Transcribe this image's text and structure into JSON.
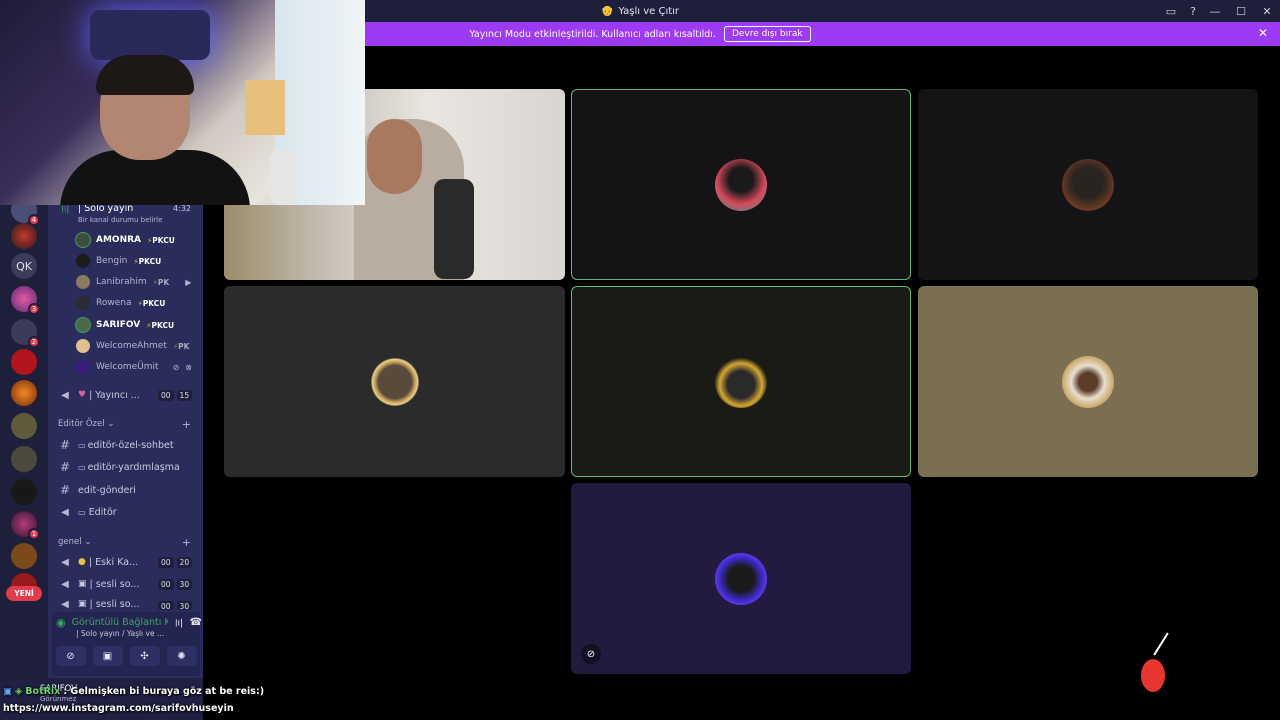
{
  "window": {
    "title": "Yaşlı ve Çıtır",
    "controls": {
      "minimize": "—",
      "maximize": "☐",
      "close": "✕"
    },
    "extra_icons": [
      "inbox-icon",
      "help-icon"
    ]
  },
  "banner": {
    "text": "Yayıncı Modu etkinleştirildi. Kullanıcı adları kısaltıldı.",
    "button": "Devre dışı bırak"
  },
  "server_rail": {
    "qk_label": "QK",
    "badges": [
      "4",
      "3",
      "2",
      "1"
    ],
    "new_label": "YENİ"
  },
  "sidebar": {
    "voice_channel": {
      "name": "| Solo yayın",
      "time": "4:32",
      "status": "Bir kanal durumu belirle"
    },
    "members": [
      {
        "name": "AMONRA",
        "tag": "PKCU",
        "bold": true
      },
      {
        "name": "Bengin",
        "tag": "PKCU",
        "bold": false
      },
      {
        "name": "Lanibrahim",
        "tag": "PK",
        "bold": false
      },
      {
        "name": "Rowena",
        "tag": "PKCU",
        "bold": false
      },
      {
        "name": "SARIFOV",
        "tag": "PKCU",
        "bold": true
      },
      {
        "name": "WelcomeAhmet",
        "tag": "PK",
        "bold": false
      },
      {
        "name": "WelcomeÜmit",
        "tag": "",
        "bold": false
      }
    ],
    "yayinci_channel": {
      "name": "| Yayıncı ...",
      "c1": "00",
      "c2": "15"
    },
    "category_editor": "Editör Özel",
    "editor_channels": [
      "editör-özel-sohbet",
      "editör-yardımlaşma",
      "edit-gönderi",
      "Editör"
    ],
    "category_general": "genel",
    "general_channels": [
      {
        "name": "| Eski Ka...",
        "c1": "00",
        "c2": "20"
      },
      {
        "name": "| sesli so...",
        "c1": "00",
        "c2": "30"
      },
      {
        "name": "| sesli so...",
        "c1": "00",
        "c2": "30"
      }
    ]
  },
  "voice_panel": {
    "title": "Görüntülü Bağlantı K",
    "subtitle": "| Solo yayın / Yaşlı ve ..."
  },
  "user_bar": {
    "name": "SARIFOV",
    "status": "Görünmez"
  },
  "chat": {
    "bot_name": "BotRix",
    "message": ": Gelmişken bi buraya göz at be reis:)",
    "link": "https://www.instagram.com/sarifovhuseyin"
  },
  "colors": {
    "banner": "#9d3af3",
    "speaking": "#5fb876",
    "tile_tan": "#7a6f52",
    "tile_purple": "#221a3f"
  }
}
